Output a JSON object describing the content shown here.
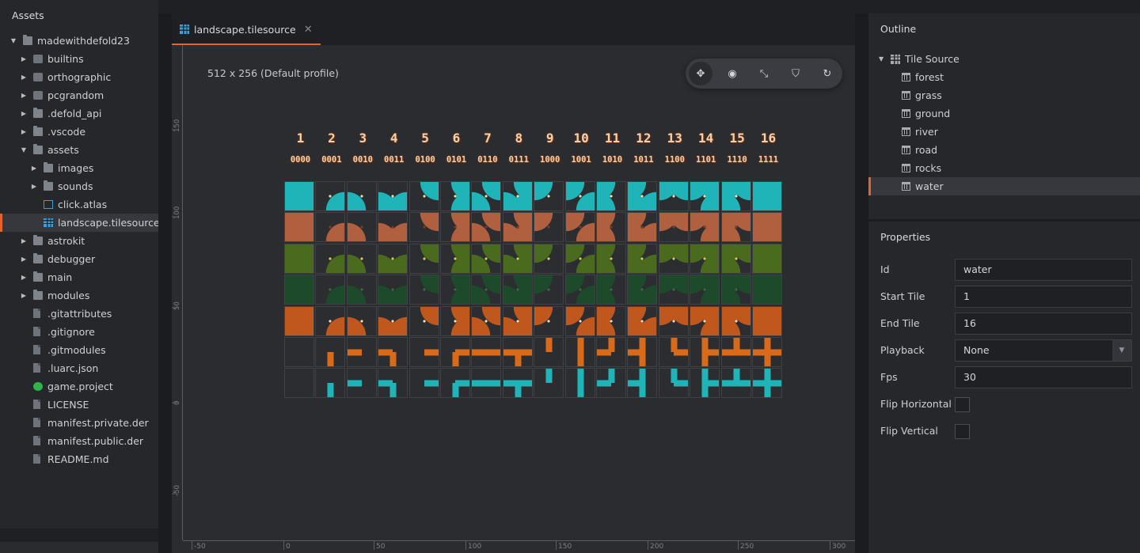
{
  "assets": {
    "title": "Assets",
    "items": [
      {
        "label": "madewithdefold23",
        "depth": 0,
        "arrow": "▼",
        "icon": "folder-icon"
      },
      {
        "label": "builtins",
        "depth": 1,
        "arrow": "▶",
        "icon": "library-icon"
      },
      {
        "label": "orthographic",
        "depth": 1,
        "arrow": "▶",
        "icon": "library-icon"
      },
      {
        "label": "pcgrandom",
        "depth": 1,
        "arrow": "▶",
        "icon": "library-icon"
      },
      {
        "label": ".defold_api",
        "depth": 1,
        "arrow": "▶",
        "icon": "folder-icon"
      },
      {
        "label": ".vscode",
        "depth": 1,
        "arrow": "▶",
        "icon": "folder-icon"
      },
      {
        "label": "assets",
        "depth": 1,
        "arrow": "▼",
        "icon": "folder-icon"
      },
      {
        "label": "images",
        "depth": 2,
        "arrow": "▶",
        "icon": "folder-icon"
      },
      {
        "label": "sounds",
        "depth": 2,
        "arrow": "▶",
        "icon": "folder-icon"
      },
      {
        "label": "click.atlas",
        "depth": 2,
        "arrow": "",
        "icon": "atlas-icon"
      },
      {
        "label": "landscape.tilesource",
        "depth": 2,
        "arrow": "",
        "icon": "tilesource-icon",
        "selected": true
      },
      {
        "label": "astrokit",
        "depth": 1,
        "arrow": "▶",
        "icon": "folder-icon"
      },
      {
        "label": "debugger",
        "depth": 1,
        "arrow": "▶",
        "icon": "folder-icon"
      },
      {
        "label": "main",
        "depth": 1,
        "arrow": "▶",
        "icon": "folder-icon"
      },
      {
        "label": "modules",
        "depth": 1,
        "arrow": "▶",
        "icon": "folder-icon"
      },
      {
        "label": ".gitattributes",
        "depth": 1,
        "arrow": "",
        "icon": "file-icon"
      },
      {
        "label": ".gitignore",
        "depth": 1,
        "arrow": "",
        "icon": "file-icon"
      },
      {
        "label": ".gitmodules",
        "depth": 1,
        "arrow": "",
        "icon": "file-icon"
      },
      {
        "label": ".luarc.json",
        "depth": 1,
        "arrow": "",
        "icon": "file-icon"
      },
      {
        "label": "game.project",
        "depth": 1,
        "arrow": "",
        "icon": "project-icon"
      },
      {
        "label": "LICENSE",
        "depth": 1,
        "arrow": "",
        "icon": "file-icon"
      },
      {
        "label": "manifest.private.der",
        "depth": 1,
        "arrow": "",
        "icon": "file-icon"
      },
      {
        "label": "manifest.public.der",
        "depth": 1,
        "arrow": "",
        "icon": "file-icon"
      },
      {
        "label": "README.md",
        "depth": 1,
        "arrow": "",
        "icon": "file-icon"
      }
    ]
  },
  "editor": {
    "tab_label": "landscape.tilesource",
    "tab_close": "✕",
    "size_label": "512 x 256 (Default profile)",
    "tools": [
      {
        "name": "move-tool",
        "glyph": "✥",
        "active": true
      },
      {
        "name": "rotate-tool",
        "glyph": "◉",
        "active": false
      },
      {
        "name": "scale-tool",
        "glyph": "⤡",
        "active": false
      },
      {
        "name": "perspective-tool",
        "glyph": "⛉",
        "active": false
      },
      {
        "name": "reset-view-tool",
        "glyph": "↻",
        "active": false
      }
    ],
    "vruler_ticks": [
      "150",
      "100",
      "50",
      "0",
      "-50"
    ],
    "hruler_ticks": [
      "-50",
      "0",
      "50",
      "100",
      "150",
      "200",
      "250",
      "300"
    ],
    "tile_numbers": [
      "1",
      "2",
      "3",
      "4",
      "5",
      "6",
      "7",
      "8",
      "9",
      "10",
      "11",
      "12",
      "13",
      "14",
      "15",
      "16"
    ],
    "tile_bits": [
      "0000",
      "0001",
      "0010",
      "0011",
      "0100",
      "0101",
      "0110",
      "0111",
      "1000",
      "1001",
      "1010",
      "1011",
      "1100",
      "1101",
      "1110",
      "1111"
    ],
    "tile_rows": [
      {
        "name": "water-row",
        "base": "#1fb5b8",
        "accent": "#e9dfb0"
      },
      {
        "name": "ground-row",
        "base": "#b0603e",
        "accent": "#7a3d25"
      },
      {
        "name": "grass-row",
        "base": "#4a6b1e",
        "accent": "#d8cf4a"
      },
      {
        "name": "forest-row",
        "base": "#1d4a2a",
        "accent": "#3c6b3a"
      },
      {
        "name": "rocks-row",
        "base": "#c0581e",
        "accent": "#f3e0b5"
      },
      {
        "name": "road-row",
        "base": "#d86a1a",
        "accent": "#a84f12"
      },
      {
        "name": "river-row",
        "base": "#1fb5b8",
        "accent": "#178d90"
      }
    ]
  },
  "outline": {
    "title": "Outline",
    "root": "Tile Source",
    "items": [
      "forest",
      "grass",
      "ground",
      "river",
      "road",
      "rocks",
      "water"
    ],
    "selected": "water"
  },
  "properties": {
    "title": "Properties",
    "fields": [
      {
        "label": "Id",
        "value": "water",
        "type": "text"
      },
      {
        "label": "Start Tile",
        "value": "1",
        "type": "text"
      },
      {
        "label": "End Tile",
        "value": "16",
        "type": "text"
      },
      {
        "label": "Playback",
        "value": "None",
        "type": "select"
      },
      {
        "label": "Fps",
        "value": "30",
        "type": "text"
      },
      {
        "label": "Flip Horizontal",
        "value": "",
        "type": "check"
      },
      {
        "label": "Flip Vertical",
        "value": "",
        "type": "check"
      }
    ]
  },
  "colors": {
    "accent": "#e8622a",
    "selection": "#37383d"
  }
}
